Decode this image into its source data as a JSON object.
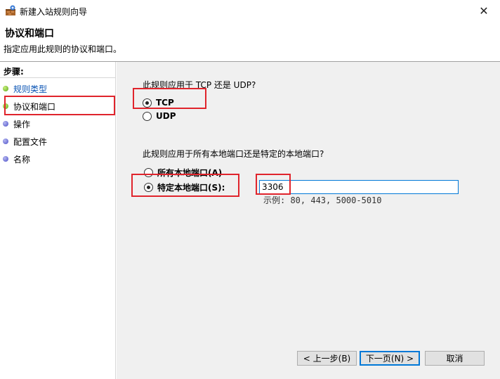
{
  "window": {
    "title": "新建入站规则向导",
    "close_glyph": "✕"
  },
  "header": {
    "heading": "协议和端口",
    "description": "指定应用此规则的协议和端口。"
  },
  "sidebar": {
    "steps_label": "步骤:",
    "items": [
      {
        "label": "规则类型",
        "state": "done"
      },
      {
        "label": "协议和端口",
        "state": "current"
      },
      {
        "label": "操作",
        "state": "pending"
      },
      {
        "label": "配置文件",
        "state": "pending"
      },
      {
        "label": "名称",
        "state": "pending"
      }
    ]
  },
  "protocol": {
    "question": "此规则应用于 TCP 还是 UDP?",
    "options": [
      {
        "label": "TCP",
        "checked": true
      },
      {
        "label": "UDP",
        "checked": false
      }
    ]
  },
  "ports": {
    "question": "此规则应用于所有本地端口还是特定的本地端口?",
    "options": [
      {
        "label": "所有本地端口(A)",
        "checked": false
      },
      {
        "label": "特定本地端口(S):",
        "checked": true
      }
    ],
    "value": "3306",
    "example": "示例: 80, 443, 5000-5010"
  },
  "buttons": {
    "back": "< 上一步(B)",
    "next": "下一页(N) >",
    "cancel": "取消"
  },
  "colors": {
    "accent": "#0078d7",
    "annotation_red": "#e0242c",
    "link": "#0a54b4"
  }
}
